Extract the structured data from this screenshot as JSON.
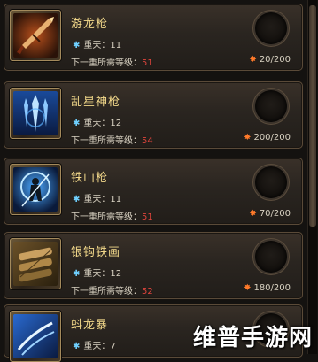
{
  "items": [
    {
      "name": "游龙枪",
      "tier_label": "重天：",
      "tier": "11",
      "req_label": "下一重所需等级：",
      "req_level": "51",
      "count": "20/200",
      "icon": "spear-red-icon"
    },
    {
      "name": "乱星神枪",
      "tier_label": "重天：",
      "tier": "12",
      "req_label": "下一重所需等级：",
      "req_level": "54",
      "count": "200/200",
      "icon": "spear-blue-icon"
    },
    {
      "name": "铁山枪",
      "tier_label": "重天：",
      "tier": "11",
      "req_label": "下一重所需等级：",
      "req_level": "51",
      "count": "70/200",
      "icon": "warrior-blue-icon"
    },
    {
      "name": "银钩铁画",
      "tier_label": "重天：",
      "tier": "12",
      "req_label": "下一重所需等级：",
      "req_level": "52",
      "count": "180/200",
      "icon": "scroll-icon"
    },
    {
      "name": "蚪龙暴",
      "tier_label": "重天：",
      "tier": "7",
      "req_label": "",
      "req_level": "",
      "count": "",
      "icon": "claw-blue-icon"
    }
  ],
  "watermark": "维普手游网",
  "colors": {
    "name": "#f2d88a",
    "level": "#e0443c",
    "tier_star": "#6fd0ff",
    "flame": "#ff7a2a"
  }
}
